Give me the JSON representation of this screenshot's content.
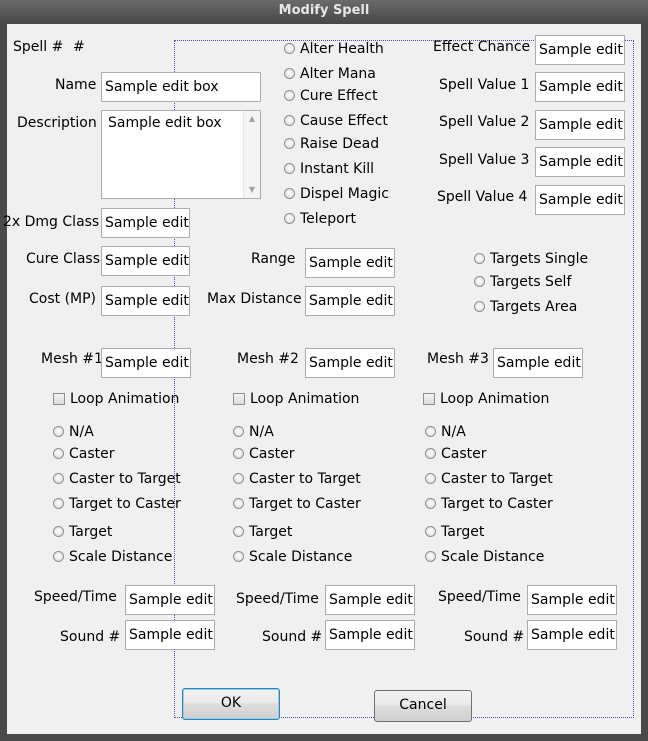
{
  "window": {
    "title": "Modify Spell"
  },
  "header": {
    "spell_no_label": "Spell #",
    "spell_no_value": "#"
  },
  "fields": {
    "name_label": "Name",
    "name_value": "Sample edit box",
    "description_label": "Description",
    "description_value": "Sample edit box",
    "dmg_class_label": "2x Dmg Class",
    "dmg_class_value": "Sample edit",
    "cure_class_label": "Cure Class",
    "cure_class_value": "Sample edit",
    "cost_label": "Cost (MP)",
    "cost_value": "Sample edit",
    "range_label": "Range",
    "range_value": "Sample edit",
    "max_distance_label": "Max Distance",
    "max_distance_value": "Sample edit",
    "effect_chance_label": "Effect Chance",
    "effect_chance_value": "Sample edit",
    "spell_value_1_label": "Spell Value 1",
    "spell_value_1_value": "Sample edit",
    "spell_value_2_label": "Spell Value 2",
    "spell_value_2_value": "Sample edit",
    "spell_value_3_label": "Spell Value 3",
    "spell_value_3_value": "Sample edit",
    "spell_value_4_label": "Spell Value 4",
    "spell_value_4_value": "Sample edit"
  },
  "effects": [
    "Alter Health",
    "Alter Mana",
    "Cure Effect",
    "Cause Effect",
    "Raise Dead",
    "Instant Kill",
    "Dispel Magic",
    "Teleport"
  ],
  "targets": [
    "Targets Single",
    "Targets Self",
    "Targets Area"
  ],
  "meshes": [
    {
      "label": "Mesh #1",
      "value": "Sample edit",
      "loop_label": "Loop Animation",
      "options": [
        "N/A",
        "Caster",
        "Caster to Target",
        "Target to Caster",
        "Target",
        "Scale Distance"
      ],
      "speed_label": "Speed/Time",
      "speed_value": "Sample edit",
      "sound_label": "Sound #",
      "sound_value": "Sample edit"
    },
    {
      "label": "Mesh #2",
      "value": "Sample edit",
      "loop_label": "Loop Animation",
      "options": [
        "N/A",
        "Caster",
        "Caster to Target",
        "Target to Caster",
        "Target",
        "Scale Distance"
      ],
      "speed_label": "Speed/Time",
      "speed_value": "Sample edit",
      "sound_label": "Sound #",
      "sound_value": "Sample edit"
    },
    {
      "label": "Mesh #3",
      "value": "Sample edit",
      "loop_label": "Loop Animation",
      "options": [
        "N/A",
        "Caster",
        "Caster to Target",
        "Target to Caster",
        "Target",
        "Scale Distance"
      ],
      "speed_label": "Speed/Time",
      "speed_value": "Sample edit",
      "sound_label": "Sound #",
      "sound_value": "Sample edit"
    }
  ],
  "buttons": {
    "ok": "OK",
    "cancel": "Cancel"
  },
  "colors": {
    "titlebar": "#4a4a4a",
    "client": "#f0f0f0",
    "focus": "#3c7fb1"
  }
}
